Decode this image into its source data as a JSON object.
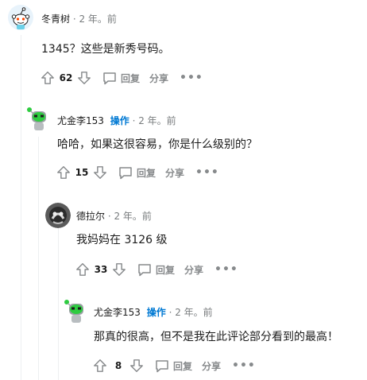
{
  "comments": [
    {
      "author": "冬青树",
      "op_label": "",
      "time": "· 2 年。前",
      "body": "1345？这些是新秀号码。",
      "score": "62",
      "reply_label": "回复",
      "share_label": "分享",
      "more_label": "•••",
      "avatar": "reddit-snoo-default"
    },
    {
      "author": "尤金李153",
      "op_label": "操作",
      "time": "· 2 年。前",
      "body": "哈哈，如果这很容易，你是什么级别的？",
      "score": "15",
      "reply_label": "回复",
      "share_label": "分享",
      "more_label": "•••",
      "avatar": "robot-green-head"
    },
    {
      "author": "德拉尔",
      "op_label": "",
      "time": "· 2 年。前",
      "body": "我妈妈在 3126 级",
      "score": "33",
      "reply_label": "回复",
      "share_label": "分享",
      "more_label": "•••",
      "avatar": "grey-photo-avatar"
    },
    {
      "author": "尤金李153",
      "op_label": "操作",
      "time": "· 2 年。前",
      "body": "那真的很高，但不是我在此评论部分看到的最高！",
      "score": "8",
      "reply_label": "回复",
      "share_label": "分享",
      "more_label": "•••",
      "avatar": "robot-green-head"
    }
  ],
  "colors": {
    "op": "#0079d3",
    "meta": "#787c7e",
    "action": "#878a8c",
    "thread": "#edeff1"
  }
}
